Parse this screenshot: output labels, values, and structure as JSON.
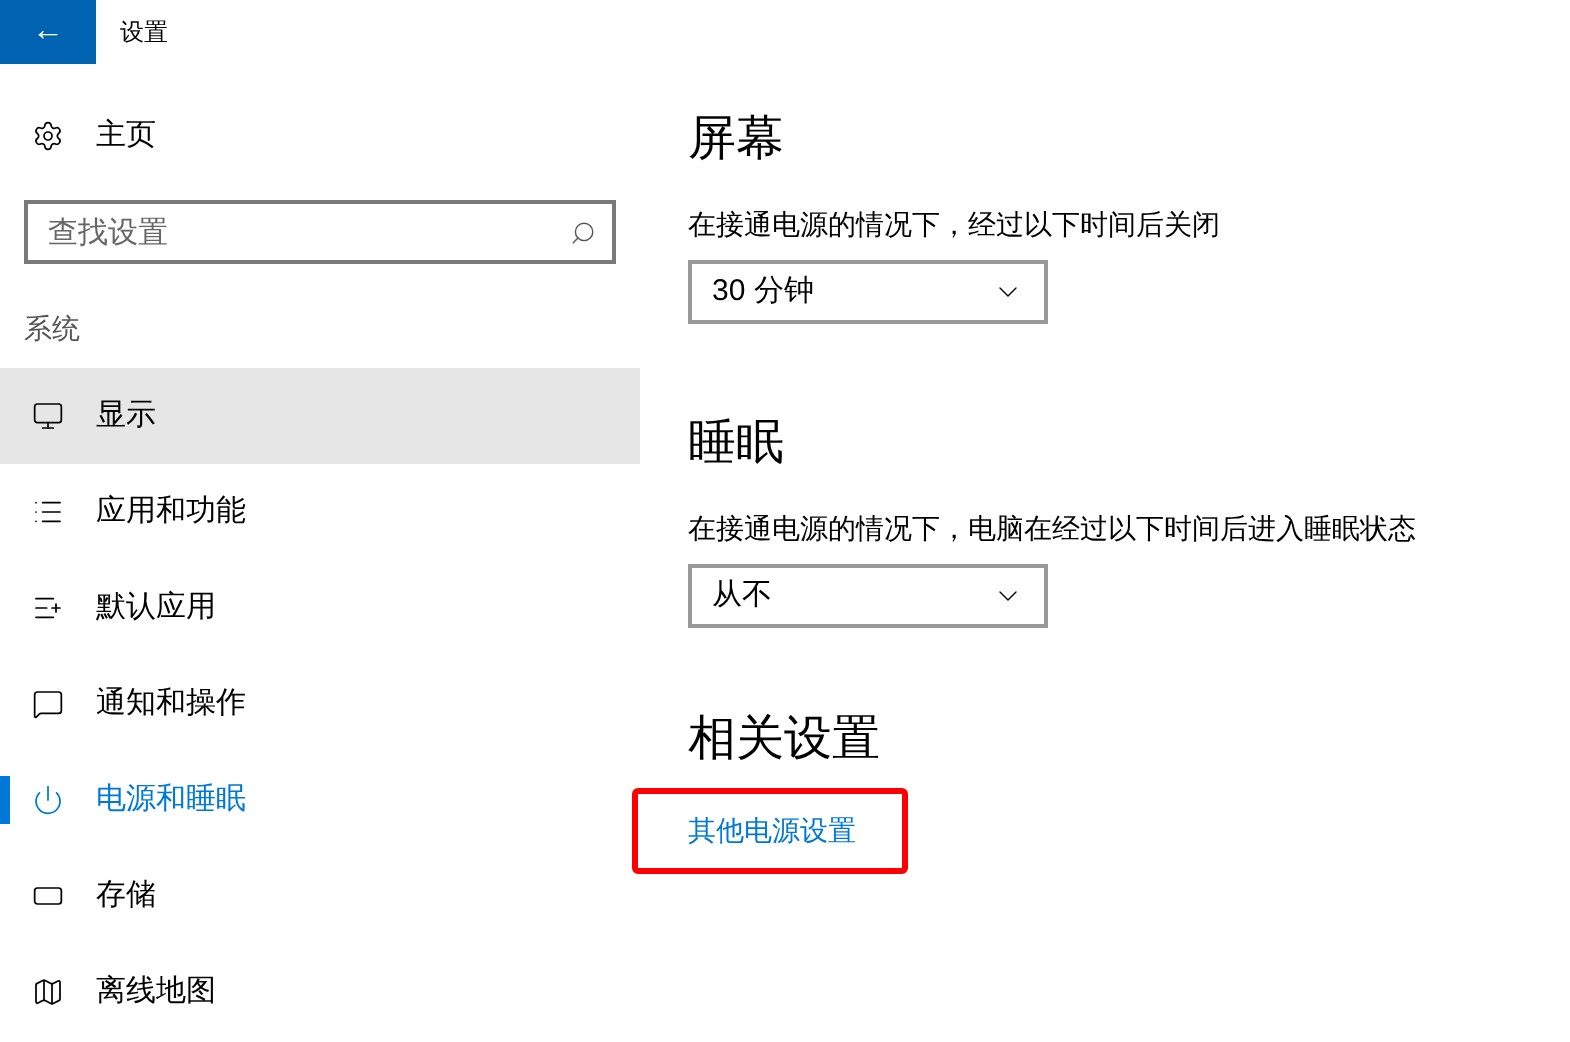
{
  "window": {
    "title": "设置",
    "back_button": "←"
  },
  "sidebar": {
    "home": "主页",
    "search": {
      "placeholder": "查找设置"
    },
    "section": "系统",
    "items": [
      {
        "label": "显示",
        "selected": false,
        "hovered": true
      },
      {
        "label": "应用和功能",
        "selected": false,
        "hovered": false
      },
      {
        "label": "默认应用",
        "selected": false,
        "hovered": false
      },
      {
        "label": "通知和操作",
        "selected": false,
        "hovered": false
      },
      {
        "label": "电源和睡眠",
        "selected": true,
        "hovered": false
      },
      {
        "label": "存储",
        "selected": false,
        "hovered": false
      },
      {
        "label": "离线地图",
        "selected": false,
        "hovered": false
      }
    ]
  },
  "content": {
    "sections": [
      {
        "heading": "屏幕",
        "description": "在接通电源的情况下，经过以下时间后关闭",
        "dropdown": {
          "value": "30 分钟"
        }
      },
      {
        "heading": "睡眠",
        "description": "在接通电源的情况下，电脑在经过以下时间后进入睡眠状态",
        "dropdown": {
          "value": "从不"
        }
      }
    ],
    "related": {
      "heading": "相关设置",
      "link": {
        "label": "其他电源设置",
        "annotated": true
      }
    }
  }
}
